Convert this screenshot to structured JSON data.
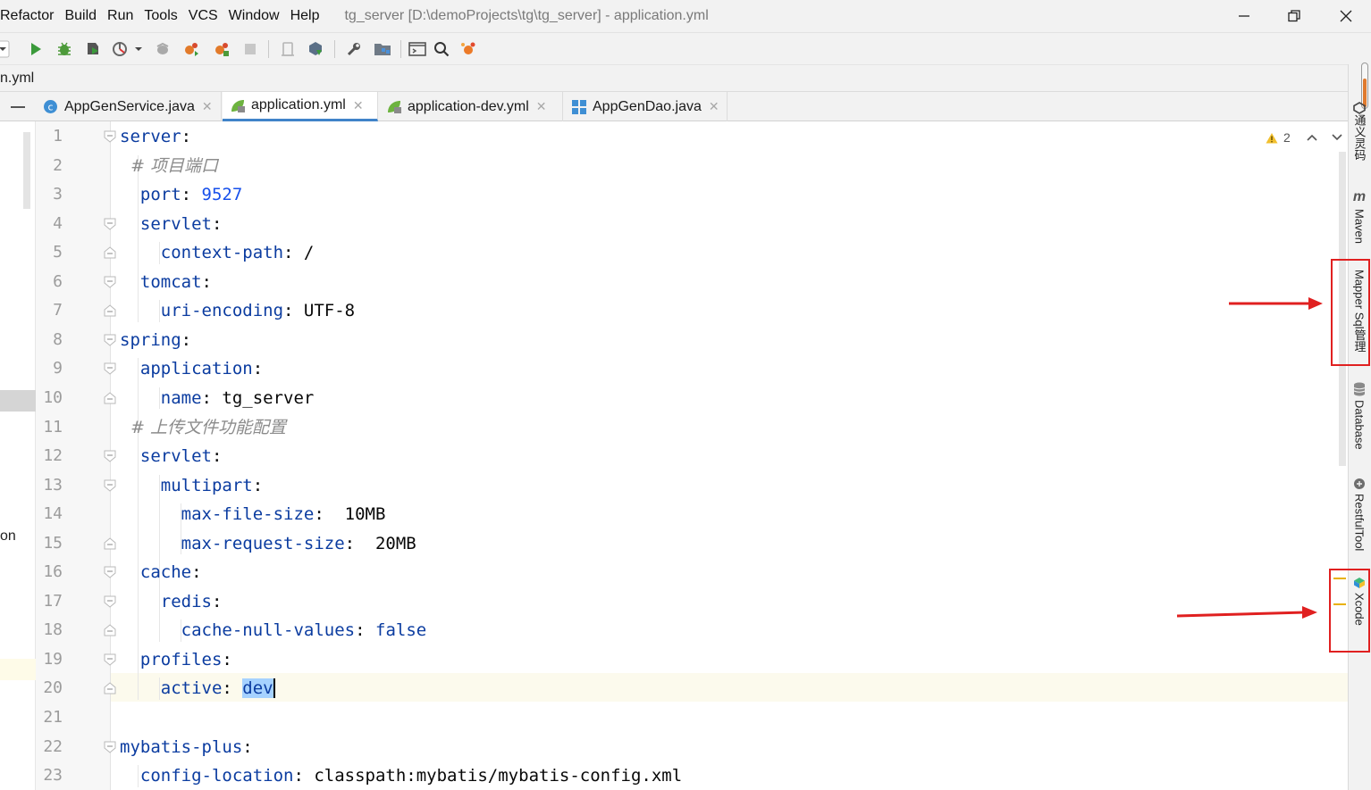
{
  "menu": [
    "Refactor",
    "Build",
    "Run",
    "Tools",
    "VCS",
    "Window",
    "Help"
  ],
  "window_title": "tg_server [D:\\demoProjects\\tg\\tg_server] - application.yml",
  "navbar": {
    "breadcrumb": "n.yml"
  },
  "tabs": [
    {
      "label": "AppGenService.java",
      "icon": "java-class-icon",
      "active": false
    },
    {
      "label": "application.yml",
      "icon": "spring-yaml-icon",
      "active": true
    },
    {
      "label": "application-dev.yml",
      "icon": "spring-yaml-icon",
      "active": false
    },
    {
      "label": "AppGenDao.java",
      "icon": "java-interface-icon",
      "active": false
    }
  ],
  "editor": {
    "warnings": "2",
    "lines": [
      {
        "n": "1",
        "parts": [
          [
            "key",
            "server"
          ],
          [
            "plain",
            ":"
          ]
        ]
      },
      {
        "n": "2",
        "parts": [
          [
            "comment",
            "  # 项目端口"
          ]
        ]
      },
      {
        "n": "3",
        "parts": [
          [
            "key",
            "  port"
          ],
          [
            "plain",
            ": "
          ],
          [
            "num",
            "9527"
          ]
        ]
      },
      {
        "n": "4",
        "parts": [
          [
            "key",
            "  servlet"
          ],
          [
            "plain",
            ":"
          ]
        ]
      },
      {
        "n": "5",
        "parts": [
          [
            "key",
            "    context-path"
          ],
          [
            "plain",
            ": /"
          ]
        ]
      },
      {
        "n": "6",
        "parts": [
          [
            "key",
            "  tomcat"
          ],
          [
            "plain",
            ":"
          ]
        ]
      },
      {
        "n": "7",
        "parts": [
          [
            "key",
            "    uri-encoding"
          ],
          [
            "plain",
            ": UTF-8"
          ]
        ]
      },
      {
        "n": "8",
        "parts": [
          [
            "key",
            "spring"
          ],
          [
            "plain",
            ":"
          ]
        ]
      },
      {
        "n": "9",
        "parts": [
          [
            "key",
            "  application"
          ],
          [
            "plain",
            ":"
          ]
        ]
      },
      {
        "n": "10",
        "parts": [
          [
            "key",
            "    name"
          ],
          [
            "plain",
            ": tg_server"
          ]
        ]
      },
      {
        "n": "11",
        "parts": [
          [
            "comment",
            "  # 上传文件功能配置"
          ]
        ]
      },
      {
        "n": "12",
        "parts": [
          [
            "key",
            "  servlet"
          ],
          [
            "plain",
            ":"
          ]
        ]
      },
      {
        "n": "13",
        "parts": [
          [
            "key",
            "    multipart"
          ],
          [
            "plain",
            ":"
          ]
        ]
      },
      {
        "n": "14",
        "parts": [
          [
            "key",
            "      max-file-size"
          ],
          [
            "plain",
            ":  10MB"
          ]
        ]
      },
      {
        "n": "15",
        "parts": [
          [
            "key",
            "      max-request-size"
          ],
          [
            "plain",
            ":  20MB"
          ]
        ]
      },
      {
        "n": "16",
        "parts": [
          [
            "key",
            "  cache"
          ],
          [
            "plain",
            ":"
          ]
        ]
      },
      {
        "n": "17",
        "parts": [
          [
            "key",
            "    redis"
          ],
          [
            "plain",
            ":"
          ]
        ]
      },
      {
        "n": "18",
        "parts": [
          [
            "key",
            "      cache-null-values"
          ],
          [
            "plain",
            ": "
          ],
          [
            "kw",
            "false"
          ]
        ]
      },
      {
        "n": "19",
        "parts": [
          [
            "key",
            "  profiles"
          ],
          [
            "plain",
            ":"
          ]
        ]
      },
      {
        "n": "20",
        "parts": [
          [
            "key",
            "    active"
          ],
          [
            "plain",
            ": "
          ],
          [
            "sel",
            "dev"
          ]
        ]
      },
      {
        "n": "21",
        "parts": []
      },
      {
        "n": "22",
        "parts": [
          [
            "key",
            "mybatis-plus"
          ],
          [
            "plain",
            ":"
          ]
        ]
      },
      {
        "n": "23",
        "parts": [
          [
            "key",
            "  config-location"
          ],
          [
            "plain",
            ": classpath:mybatis/mybatis-config.xml"
          ]
        ]
      }
    ]
  },
  "right_tools": [
    {
      "label": "通义灵码",
      "icon": "tongyi-icon"
    },
    {
      "label": "Maven",
      "icon": "maven-icon"
    },
    {
      "label": "Mapper Sql管理",
      "icon": ""
    },
    {
      "label": "Database",
      "icon": "database-icon"
    },
    {
      "label": "RestfulTool",
      "icon": "restful-icon"
    },
    {
      "label": "Xcode",
      "icon": "xcode-icon"
    }
  ],
  "left_panel": {
    "fragment": "on"
  },
  "colors": {
    "annotation": "#e02020",
    "tab_underline": "#4083c9",
    "selection": "#a6d2ff"
  }
}
